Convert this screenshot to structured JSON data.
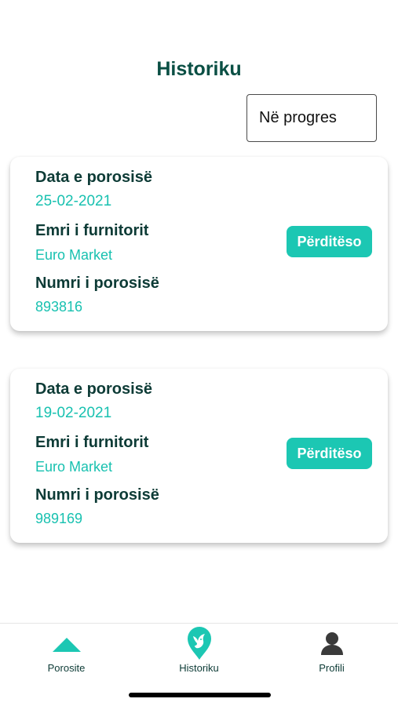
{
  "header": {
    "title": "Historiku"
  },
  "filter": {
    "selected": "Në progres"
  },
  "orders": [
    {
      "date_label": "Data e porosisë",
      "date": "25-02-2021",
      "supplier_label": "Emri i furnitorit",
      "supplier": "Euro Market",
      "number_label": "Numri i porosisë",
      "number": "893816",
      "action": "Përditëso"
    },
    {
      "date_label": "Data e porosisë",
      "date": "19-02-2021",
      "supplier_label": "Emri i furnitorit",
      "supplier": "Euro Market",
      "number_label": "Numri i porosisë",
      "number": "989169",
      "action": "Përditëso"
    }
  ],
  "nav": {
    "tabs": [
      {
        "label": "Porosite",
        "icon": "triangle-up-icon"
      },
      {
        "label": "Historiku",
        "icon": "bird-pin-icon"
      },
      {
        "label": "Profili",
        "icon": "user-icon"
      }
    ],
    "accent": "#1cc7b3"
  },
  "colors": {
    "title": "#0a4f44",
    "value": "#18c1b0",
    "button": "#1cc7b3"
  }
}
